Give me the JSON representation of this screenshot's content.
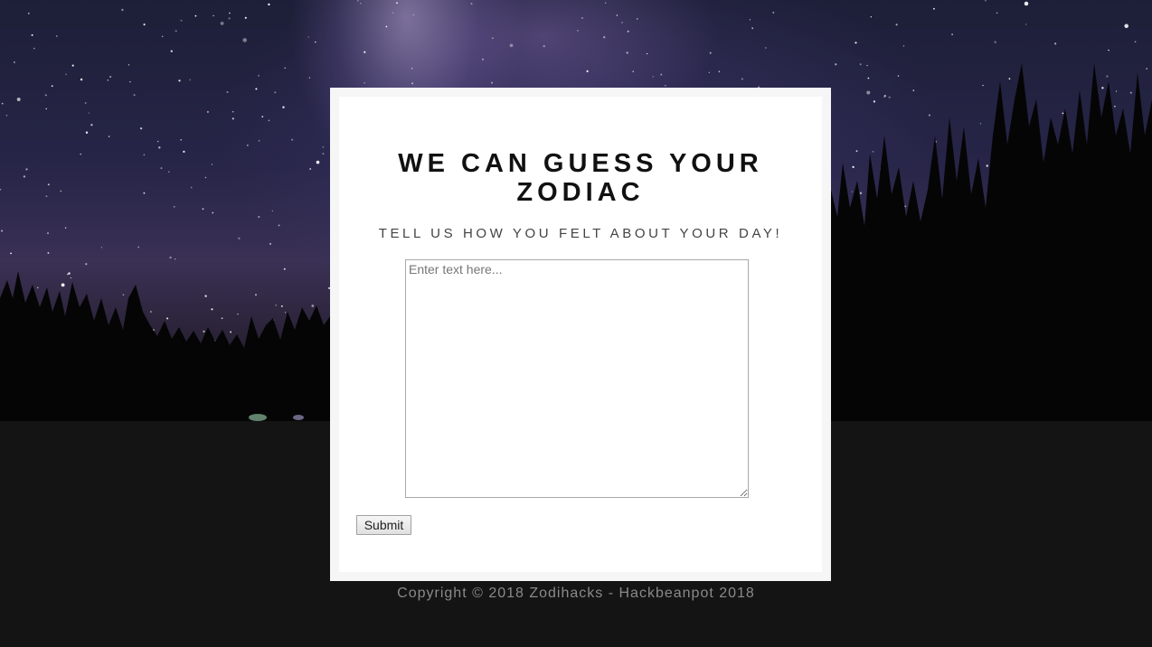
{
  "header": {
    "title": "WE CAN GUESS YOUR ZODIAC",
    "subtitle": "TELL US HOW YOU FELT ABOUT YOUR DAY!"
  },
  "form": {
    "textarea_placeholder": "Enter text here...",
    "textarea_value": "",
    "submit_label": "Submit"
  },
  "footer": {
    "copyright": "Copyright © 2018 Zodihacks - Hackbeanpot 2018"
  },
  "colors": {
    "page_background": "#141414",
    "card_border": "#f6f6f6",
    "card_background": "#ffffff",
    "title_text": "#111111",
    "subtitle_text": "#444444",
    "footer_text": "#8a8a8a"
  },
  "icons": {
    "textarea_resize": "resize-grip-icon"
  }
}
